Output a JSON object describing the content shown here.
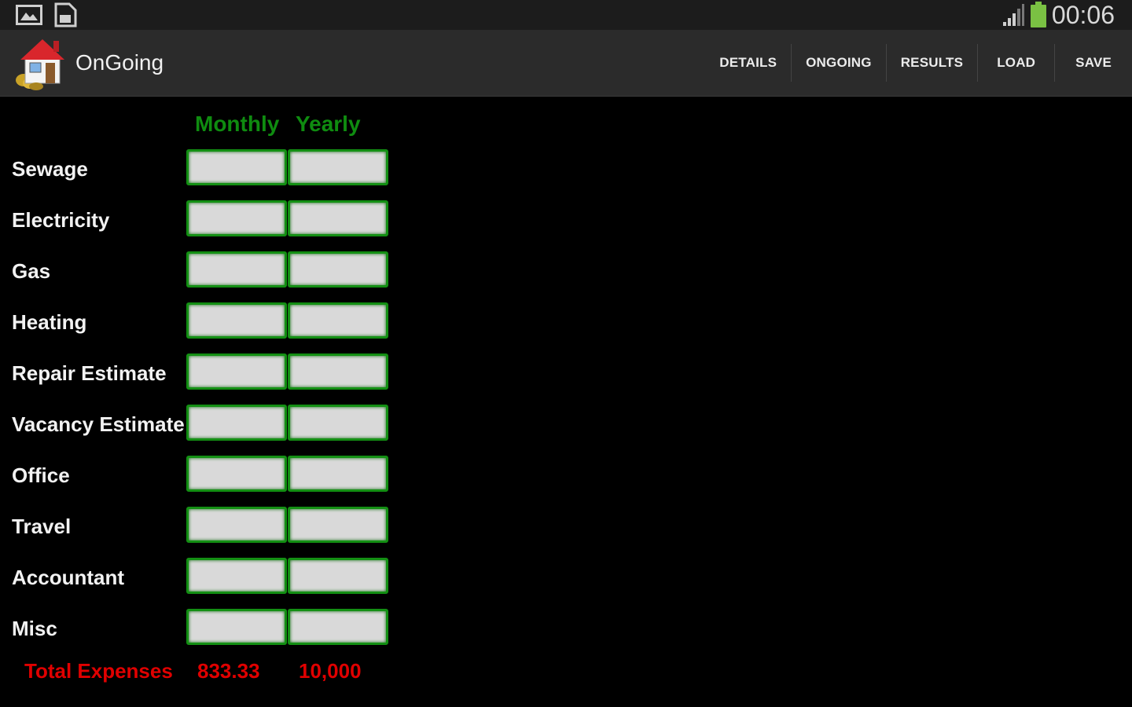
{
  "status_bar": {
    "time": "00:06",
    "icons": [
      "picture-icon",
      "sd-card-icon",
      "signal-icon",
      "battery-icon"
    ],
    "battery_color": "#7ac143"
  },
  "action_bar": {
    "title": "OnGoing",
    "actions": [
      "DETAILS",
      "ONGOING",
      "RESULTS",
      "LOAD",
      "SAVE"
    ]
  },
  "table": {
    "headers": {
      "monthly": "Monthly",
      "yearly": "Yearly"
    },
    "header_color": "#0f8c10",
    "rows": [
      {
        "label": "Sewage",
        "monthly": "",
        "yearly": ""
      },
      {
        "label": "Electricity",
        "monthly": "",
        "yearly": ""
      },
      {
        "label": "Gas",
        "monthly": "",
        "yearly": ""
      },
      {
        "label": "Heating",
        "monthly": "",
        "yearly": ""
      },
      {
        "label": "Repair Estimate",
        "monthly": "",
        "yearly": ""
      },
      {
        "label": "Vacancy Estimate",
        "monthly": "",
        "yearly": ""
      },
      {
        "label": "Office",
        "monthly": "",
        "yearly": ""
      },
      {
        "label": "Travel",
        "monthly": "",
        "yearly": ""
      },
      {
        "label": "Accountant",
        "monthly": "",
        "yearly": ""
      },
      {
        "label": "Misc",
        "monthly": "",
        "yearly": ""
      }
    ],
    "total": {
      "label": "Total Expenses",
      "monthly": "833.33",
      "yearly": "10,000",
      "color": "#e00000"
    }
  }
}
